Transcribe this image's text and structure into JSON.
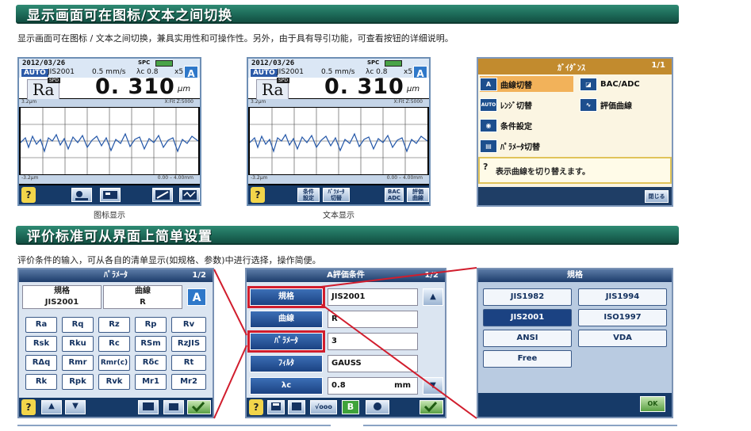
{
  "section1": {
    "heading": "显示画面可在图标/文本之间切换",
    "description": "显示画面可在图标 / 文本之间切换，兼具实用性和可操作性。另外，由于具有导引功能，可查看按钮的详细说明。",
    "caption_icon": "图标显示",
    "caption_text": "文本显示"
  },
  "screen": {
    "date": "2012/03/26",
    "spc": "SPC",
    "auto": "AUTO",
    "standard": "JIS2001",
    "speed": "0.5 mm/s",
    "cutoff": "λc 0.8",
    "mag": "x5",
    "a_label": "A",
    "param": "Ra",
    "spd_badge": "SPD",
    "value": "0. 310",
    "unit": "μm",
    "info_left": "3.2μm",
    "info_right": "X:Fit  Z:5000",
    "bot_left": "-3.2μm",
    "bot_right": "0.00 – 4.00mm",
    "q": "?",
    "text_buttons": [
      "条件\n設定",
      "ﾊﾟﾗﾒｰﾀ\n切替",
      "BAC\nADC",
      "評価\n曲線"
    ]
  },
  "guide": {
    "title": "ｶﾞｲﾀﾞﾝｽ",
    "page": "1/1",
    "items": [
      {
        "icon": "A",
        "label": "曲線切替"
      },
      {
        "icon": "BAC",
        "label": "BAC/ADC"
      },
      {
        "icon": "AUTO",
        "label": "ﾚﾝｼﾞ切替"
      },
      {
        "icon": "EVL",
        "label": "評価曲線"
      },
      {
        "icon": "COND",
        "label": "条件設定"
      },
      {
        "icon": "PRM",
        "label": "ﾊﾟﾗﾒｰﾀ切替"
      }
    ],
    "help": "表示曲線を切り替えます。",
    "close": "閉じる"
  },
  "section2": {
    "heading": "评价标准可从界面上简单设置",
    "description": "评价条件的输入，可从各自的清单显示(如规格、参数)中进行选择，操作简便。"
  },
  "param_panel": {
    "title": "ﾊﾟﾗﾒｰﾀ",
    "page": "1/2",
    "std_label": "規格",
    "std_value": "JIS2001",
    "curve_label": "曲線",
    "curve_value": "R",
    "a_label": "A",
    "rows": [
      [
        "Ra",
        "Rq",
        "Rz",
        "Rp",
        "Rv"
      ],
      [
        "Rsk",
        "Rku",
        "Rc",
        "RSm",
        "RzJIS"
      ],
      [
        "RΔq",
        "Rmr",
        "Rmr(c)",
        "Rδc",
        "Rt"
      ],
      [
        "Rk",
        "Rpk",
        "Rvk",
        "Mr1",
        "Mr2"
      ]
    ]
  },
  "eval_panel": {
    "title": "A評価条件",
    "page": "1/2",
    "rows": [
      {
        "label": "規格",
        "value": "JIS2001"
      },
      {
        "label": "曲線",
        "value": "R"
      },
      {
        "label": "ﾊﾟﾗﾒｰﾀ",
        "value": "3"
      },
      {
        "label": "ﾌｨﾙﾀ",
        "value": "GAUSS"
      },
      {
        "label": "λc",
        "value": "0.8",
        "unit": "mm"
      }
    ],
    "bottom_a": "√ooo",
    "bottom_b": "B"
  },
  "std_panel": {
    "title": "規格",
    "options": [
      "JIS1982",
      "JIS1994",
      "JIS2001",
      "ISO1997",
      "ANSI",
      "VDA",
      "Free"
    ],
    "ok": "OK"
  }
}
